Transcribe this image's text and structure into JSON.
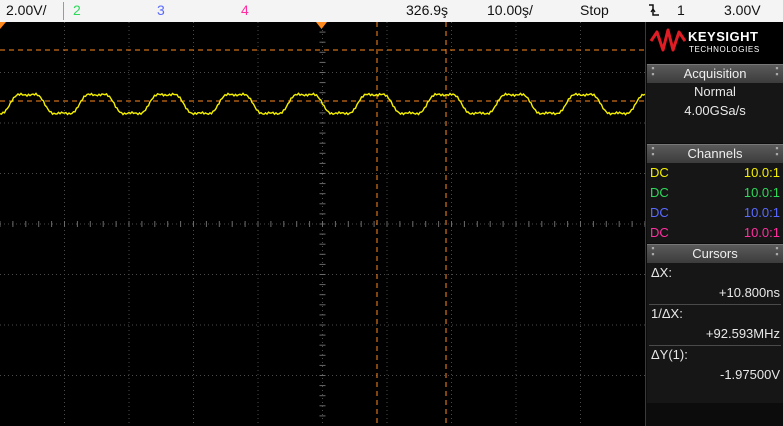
{
  "topbar": {
    "ch1_scale": "2.00V/",
    "ch2": "2",
    "ch3": "3",
    "ch4": "4",
    "time_offset": "326.9ş",
    "time_scale": "10.00ş/",
    "run_state": "Stop",
    "trigger_icon": "trigger-edge-falling-icon",
    "trigger_source": "1",
    "trigger_level": "3.00V"
  },
  "colors": {
    "ch1": "#f4f000",
    "ch2": "#2ed85a",
    "ch3": "#5a6aff",
    "ch4": "#ff2fa0",
    "cursor": "#ff8a1e",
    "grid": "#4a4a4a"
  },
  "logo": {
    "brand": "KEYSIGHT",
    "sub": "TECHNOLOGIES",
    "icon": "keysight-wave-icon"
  },
  "acquisition": {
    "title": "Acquisition",
    "mode": "Normal",
    "rate": "4.00GSa/s"
  },
  "channels": {
    "title": "Channels",
    "rows": [
      {
        "coupling": "DC",
        "probe": "10.0:1",
        "color": "#f4f000"
      },
      {
        "coupling": "DC",
        "probe": "10.0:1",
        "color": "#2ed85a"
      },
      {
        "coupling": "DC",
        "probe": "10.0:1",
        "color": "#5a6aff"
      },
      {
        "coupling": "DC",
        "probe": "10.0:1",
        "color": "#ff2fa0"
      }
    ]
  },
  "cursors": {
    "title": "Cursors",
    "dx_label": "ΔX:",
    "dx_value": "+10.800ns",
    "inv_label": "1/ΔX:",
    "inv_value": "+92.593MHz",
    "dy_label": "ΔY(1):",
    "dy_value": "-1.97500V"
  }
}
